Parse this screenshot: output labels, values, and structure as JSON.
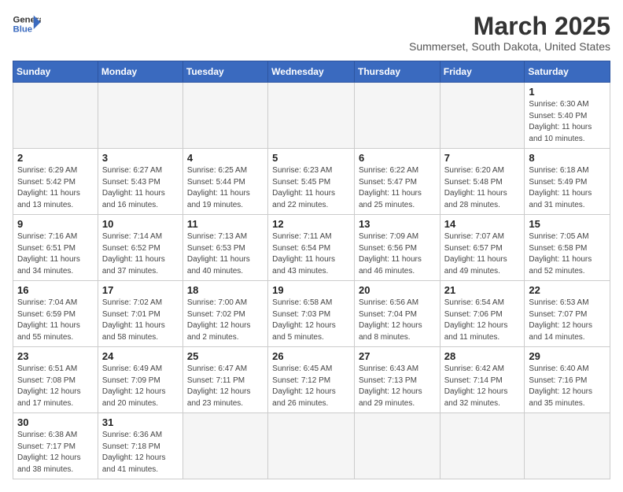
{
  "header": {
    "logo_general": "General",
    "logo_blue": "Blue",
    "title": "March 2025",
    "subtitle": "Summerset, South Dakota, United States"
  },
  "weekdays": [
    "Sunday",
    "Monday",
    "Tuesday",
    "Wednesday",
    "Thursday",
    "Friday",
    "Saturday"
  ],
  "weeks": [
    [
      {
        "day": "",
        "info": ""
      },
      {
        "day": "",
        "info": ""
      },
      {
        "day": "",
        "info": ""
      },
      {
        "day": "",
        "info": ""
      },
      {
        "day": "",
        "info": ""
      },
      {
        "day": "",
        "info": ""
      },
      {
        "day": "1",
        "info": "Sunrise: 6:30 AM\nSunset: 5:40 PM\nDaylight: 11 hours\nand 10 minutes."
      }
    ],
    [
      {
        "day": "2",
        "info": "Sunrise: 6:29 AM\nSunset: 5:42 PM\nDaylight: 11 hours\nand 13 minutes."
      },
      {
        "day": "3",
        "info": "Sunrise: 6:27 AM\nSunset: 5:43 PM\nDaylight: 11 hours\nand 16 minutes."
      },
      {
        "day": "4",
        "info": "Sunrise: 6:25 AM\nSunset: 5:44 PM\nDaylight: 11 hours\nand 19 minutes."
      },
      {
        "day": "5",
        "info": "Sunrise: 6:23 AM\nSunset: 5:45 PM\nDaylight: 11 hours\nand 22 minutes."
      },
      {
        "day": "6",
        "info": "Sunrise: 6:22 AM\nSunset: 5:47 PM\nDaylight: 11 hours\nand 25 minutes."
      },
      {
        "day": "7",
        "info": "Sunrise: 6:20 AM\nSunset: 5:48 PM\nDaylight: 11 hours\nand 28 minutes."
      },
      {
        "day": "8",
        "info": "Sunrise: 6:18 AM\nSunset: 5:49 PM\nDaylight: 11 hours\nand 31 minutes."
      }
    ],
    [
      {
        "day": "9",
        "info": "Sunrise: 7:16 AM\nSunset: 6:51 PM\nDaylight: 11 hours\nand 34 minutes."
      },
      {
        "day": "10",
        "info": "Sunrise: 7:14 AM\nSunset: 6:52 PM\nDaylight: 11 hours\nand 37 minutes."
      },
      {
        "day": "11",
        "info": "Sunrise: 7:13 AM\nSunset: 6:53 PM\nDaylight: 11 hours\nand 40 minutes."
      },
      {
        "day": "12",
        "info": "Sunrise: 7:11 AM\nSunset: 6:54 PM\nDaylight: 11 hours\nand 43 minutes."
      },
      {
        "day": "13",
        "info": "Sunrise: 7:09 AM\nSunset: 6:56 PM\nDaylight: 11 hours\nand 46 minutes."
      },
      {
        "day": "14",
        "info": "Sunrise: 7:07 AM\nSunset: 6:57 PM\nDaylight: 11 hours\nand 49 minutes."
      },
      {
        "day": "15",
        "info": "Sunrise: 7:05 AM\nSunset: 6:58 PM\nDaylight: 11 hours\nand 52 minutes."
      }
    ],
    [
      {
        "day": "16",
        "info": "Sunrise: 7:04 AM\nSunset: 6:59 PM\nDaylight: 11 hours\nand 55 minutes."
      },
      {
        "day": "17",
        "info": "Sunrise: 7:02 AM\nSunset: 7:01 PM\nDaylight: 11 hours\nand 58 minutes."
      },
      {
        "day": "18",
        "info": "Sunrise: 7:00 AM\nSunset: 7:02 PM\nDaylight: 12 hours\nand 2 minutes."
      },
      {
        "day": "19",
        "info": "Sunrise: 6:58 AM\nSunset: 7:03 PM\nDaylight: 12 hours\nand 5 minutes."
      },
      {
        "day": "20",
        "info": "Sunrise: 6:56 AM\nSunset: 7:04 PM\nDaylight: 12 hours\nand 8 minutes."
      },
      {
        "day": "21",
        "info": "Sunrise: 6:54 AM\nSunset: 7:06 PM\nDaylight: 12 hours\nand 11 minutes."
      },
      {
        "day": "22",
        "info": "Sunrise: 6:53 AM\nSunset: 7:07 PM\nDaylight: 12 hours\nand 14 minutes."
      }
    ],
    [
      {
        "day": "23",
        "info": "Sunrise: 6:51 AM\nSunset: 7:08 PM\nDaylight: 12 hours\nand 17 minutes."
      },
      {
        "day": "24",
        "info": "Sunrise: 6:49 AM\nSunset: 7:09 PM\nDaylight: 12 hours\nand 20 minutes."
      },
      {
        "day": "25",
        "info": "Sunrise: 6:47 AM\nSunset: 7:11 PM\nDaylight: 12 hours\nand 23 minutes."
      },
      {
        "day": "26",
        "info": "Sunrise: 6:45 AM\nSunset: 7:12 PM\nDaylight: 12 hours\nand 26 minutes."
      },
      {
        "day": "27",
        "info": "Sunrise: 6:43 AM\nSunset: 7:13 PM\nDaylight: 12 hours\nand 29 minutes."
      },
      {
        "day": "28",
        "info": "Sunrise: 6:42 AM\nSunset: 7:14 PM\nDaylight: 12 hours\nand 32 minutes."
      },
      {
        "day": "29",
        "info": "Sunrise: 6:40 AM\nSunset: 7:16 PM\nDaylight: 12 hours\nand 35 minutes."
      }
    ],
    [
      {
        "day": "30",
        "info": "Sunrise: 6:38 AM\nSunset: 7:17 PM\nDaylight: 12 hours\nand 38 minutes."
      },
      {
        "day": "31",
        "info": "Sunrise: 6:36 AM\nSunset: 7:18 PM\nDaylight: 12 hours\nand 41 minutes."
      },
      {
        "day": "",
        "info": ""
      },
      {
        "day": "",
        "info": ""
      },
      {
        "day": "",
        "info": ""
      },
      {
        "day": "",
        "info": ""
      },
      {
        "day": "",
        "info": ""
      }
    ]
  ]
}
